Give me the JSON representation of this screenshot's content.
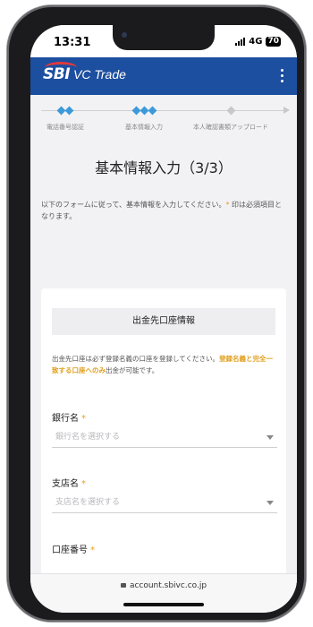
{
  "status": {
    "time": "13:31",
    "network": "4G",
    "battery": "70"
  },
  "app": {
    "brand": "SBI",
    "brand_suffix": "VC Trade"
  },
  "steps": [
    {
      "label": "電話番号認証",
      "diamonds": 2,
      "state": "done"
    },
    {
      "label": "基本情報入力",
      "diamonds": 3,
      "state": "current"
    },
    {
      "label": "本人確認書類アップロード",
      "diamonds": 1,
      "state": "pending"
    }
  ],
  "page": {
    "title": "基本情報入力（3/3）",
    "intro_text": "以下のフォームに従って、基本情報を入力してください。",
    "intro_req_mark": "*",
    "intro_text_after": " 印は必須項目となります。"
  },
  "section": {
    "heading": "出金先口座情報",
    "note_before": "出金先口座は必ず登録名義の口座を登録してください。",
    "note_highlight": "登録名義と完全一致する口座へのみ",
    "note_after": "出金が可能です。"
  },
  "fields": {
    "bank": {
      "label": "銀行名",
      "required_mark": "*",
      "placeholder": "銀行名を選択する"
    },
    "branch": {
      "label": "支店名",
      "required_mark": "*",
      "placeholder": "支店名を選択する"
    },
    "account": {
      "label": "口座番号",
      "required_mark": "*",
      "value": ""
    }
  },
  "browser": {
    "url": "account.sbivc.co.jp"
  },
  "colors": {
    "brand": "#1d4fa0",
    "accent": "#3d9ad8",
    "required": "#e8a020",
    "logo_arc": "#e23a3a"
  },
  "icons": [
    "lock-icon",
    "kebab-menu-icon",
    "caret-down-icon",
    "signal-icon",
    "battery-icon"
  ]
}
